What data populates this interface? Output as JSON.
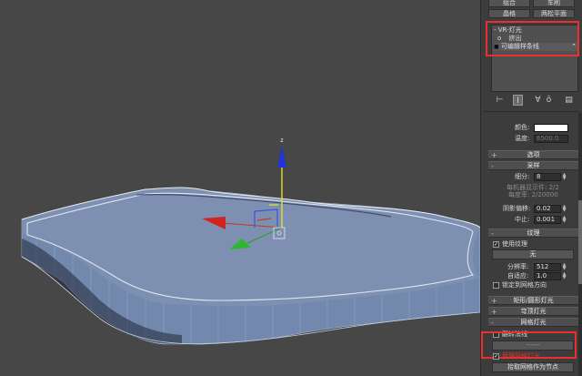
{
  "panel": {
    "top_buttons": [
      "组合",
      "车削",
      "晶格",
      "两松平面"
    ],
    "modifier_stack": {
      "items": [
        {
          "label": "VR-灯光",
          "prefix": "-"
        },
        {
          "label": "挤出",
          "prefix": "o"
        },
        {
          "label": "可编辑样条线",
          "prefix": "■"
        }
      ],
      "selected_index": 2
    },
    "tools": [
      "pin-icon",
      "show-end-result-icon",
      "make-unique-icon",
      "remove-modifier-icon",
      "configure-sets-icon"
    ],
    "color": {
      "label": "颜色:",
      "value": "#ffffff"
    },
    "temperature": {
      "label": "温度:",
      "value": "6500.0"
    },
    "options_section": "选项",
    "sampling": {
      "title": "采样",
      "subdivs_label": "细分:",
      "subdivs_value": "8",
      "adaptive_text": "每机器显示件: 2/2",
      "cutoff_text": "每度率: 2/20000",
      "shadow_bias_label": "阴影偏移:",
      "shadow_bias_value": "0.02",
      "cutoff_label": "中止:",
      "cutoff_value": "0.001"
    },
    "texture": {
      "title": "纹理",
      "use_texture_label": "使用纹理",
      "use_texture_checked": true,
      "none_button": "无",
      "resolution_label": "分辨率:",
      "resolution_value": "512",
      "adaptive_label": "自适应:",
      "adaptive_value": "1.0",
      "lock_label": "锁定到网格方向",
      "lock_checked": false
    },
    "rollouts": [
      {
        "sign": "+",
        "label": "矩形/圆形灯光"
      },
      {
        "sign": "+",
        "label": "穹顶灯光"
      },
      {
        "sign": "-",
        "label": "网格灯光"
      }
    ],
    "mesh_light": {
      "flip_normals_label": "翻转法线",
      "flip_normals_checked": false,
      "pick_button": "------",
      "replace_label": "替换网格灯光",
      "replace_checked": true,
      "extract_button": "拾取网格作为节点"
    }
  },
  "colors": {
    "viewport_bg": "#474747",
    "mesh_fill": "#7d90b1",
    "highlight": "#e8312f"
  }
}
